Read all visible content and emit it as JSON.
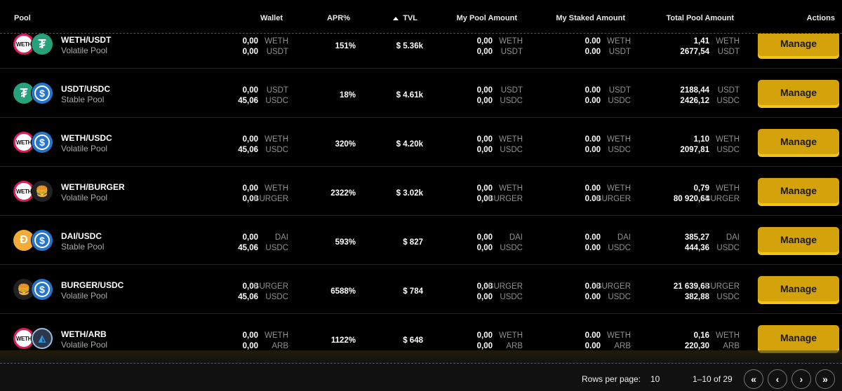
{
  "header": {
    "pool": "Pool",
    "wallet": "Wallet",
    "apr": "APR%",
    "tvl": "TVL",
    "my_pool_amount": "My Pool Amount",
    "my_staked_amount": "My Staked Amount",
    "total_pool_amount": "Total Pool Amount",
    "actions": "Actions"
  },
  "manage_label": "Manage",
  "rows": [
    {
      "name": "WETH/USDT",
      "type": "Volatile Pool",
      "icons": [
        "weth-icon",
        "usdt-icon"
      ],
      "wallet": [
        [
          "0,00",
          "WETH"
        ],
        [
          "0,00",
          "USDT"
        ]
      ],
      "apr": "151%",
      "tvl": "$ 5.36k",
      "my_pool": [
        [
          "0,00",
          "WETH"
        ],
        [
          "0,00",
          "USDT"
        ]
      ],
      "my_staked": [
        [
          "0.00",
          "WETH"
        ],
        [
          "0.00",
          "USDT"
        ]
      ],
      "total": [
        [
          "1,41",
          "WETH"
        ],
        [
          "2677,54",
          "USDT"
        ]
      ]
    },
    {
      "name": "USDT/USDC",
      "type": "Stable Pool",
      "icons": [
        "usdt-icon",
        "usdc-icon"
      ],
      "wallet": [
        [
          "0,00",
          "USDT"
        ],
        [
          "45,06",
          "USDC"
        ]
      ],
      "apr": "18%",
      "tvl": "$ 4.61k",
      "my_pool": [
        [
          "0,00",
          "USDT"
        ],
        [
          "0,00",
          "USDC"
        ]
      ],
      "my_staked": [
        [
          "0.00",
          "USDT"
        ],
        [
          "0.00",
          "USDC"
        ]
      ],
      "total": [
        [
          "2188,44",
          "USDT"
        ],
        [
          "2426,12",
          "USDC"
        ]
      ]
    },
    {
      "name": "WETH/USDC",
      "type": "Volatile Pool",
      "icons": [
        "weth-icon",
        "usdc-icon"
      ],
      "wallet": [
        [
          "0,00",
          "WETH"
        ],
        [
          "45,06",
          "USDC"
        ]
      ],
      "apr": "320%",
      "tvl": "$ 4.20k",
      "my_pool": [
        [
          "0,00",
          "WETH"
        ],
        [
          "0,00",
          "USDC"
        ]
      ],
      "my_staked": [
        [
          "0.00",
          "WETH"
        ],
        [
          "0.00",
          "USDC"
        ]
      ],
      "total": [
        [
          "1,10",
          "WETH"
        ],
        [
          "2097,81",
          "USDC"
        ]
      ]
    },
    {
      "name": "WETH/BURGER",
      "type": "Volatile Pool",
      "icons": [
        "weth-icon",
        "burger-icon"
      ],
      "wallet": [
        [
          "0,00",
          "WETH"
        ],
        [
          "0,00",
          "BURGER"
        ]
      ],
      "apr": "2322%",
      "tvl": "$ 3.02k",
      "my_pool": [
        [
          "0,00",
          "WETH"
        ],
        [
          "0,00",
          "BURGER"
        ]
      ],
      "my_staked": [
        [
          "0.00",
          "WETH"
        ],
        [
          "0.00",
          "BURGER"
        ]
      ],
      "total": [
        [
          "0,79",
          "WETH"
        ],
        [
          "80 920,64",
          "BURGER"
        ]
      ]
    },
    {
      "name": "DAI/USDC",
      "type": "Stable Pool",
      "icons": [
        "dai-icon",
        "usdc-icon"
      ],
      "wallet": [
        [
          "0,00",
          "DAI"
        ],
        [
          "45,06",
          "USDC"
        ]
      ],
      "apr": "593%",
      "tvl": "$ 827",
      "my_pool": [
        [
          "0,00",
          "DAI"
        ],
        [
          "0,00",
          "USDC"
        ]
      ],
      "my_staked": [
        [
          "0.00",
          "DAI"
        ],
        [
          "0.00",
          "USDC"
        ]
      ],
      "total": [
        [
          "385,27",
          "DAI"
        ],
        [
          "444,36",
          "USDC"
        ]
      ]
    },
    {
      "name": "BURGER/USDC",
      "type": "Volatile Pool",
      "icons": [
        "burger-icon",
        "usdc-icon"
      ],
      "wallet": [
        [
          "0,00",
          "BURGER"
        ],
        [
          "45,06",
          "USDC"
        ]
      ],
      "apr": "6588%",
      "tvl": "$ 784",
      "my_pool": [
        [
          "0,00",
          "BURGER"
        ],
        [
          "0,00",
          "USDC"
        ]
      ],
      "my_staked": [
        [
          "0.00",
          "BURGER"
        ],
        [
          "0.00",
          "USDC"
        ]
      ],
      "total": [
        [
          "21 639,68",
          "BURGER"
        ],
        [
          "382,88",
          "USDC"
        ]
      ]
    },
    {
      "name": "WETH/ARB",
      "type": "Volatile Pool",
      "icons": [
        "weth-icon",
        "arb-icon"
      ],
      "wallet": [
        [
          "0,00",
          "WETH"
        ],
        [
          "0,00",
          "ARB"
        ]
      ],
      "apr": "1122%",
      "tvl": "$ 648",
      "my_pool": [
        [
          "0,00",
          "WETH"
        ],
        [
          "0,00",
          "ARB"
        ]
      ],
      "my_staked": [
        [
          "0.00",
          "WETH"
        ],
        [
          "0.00",
          "ARB"
        ]
      ],
      "total": [
        [
          "0,16",
          "WETH"
        ],
        [
          "220,30",
          "ARB"
        ]
      ]
    }
  ],
  "footer": {
    "rows_per_page_label": "Rows per page:",
    "rows_per_page_value": "10",
    "page_info": "1–10 of 29"
  }
}
